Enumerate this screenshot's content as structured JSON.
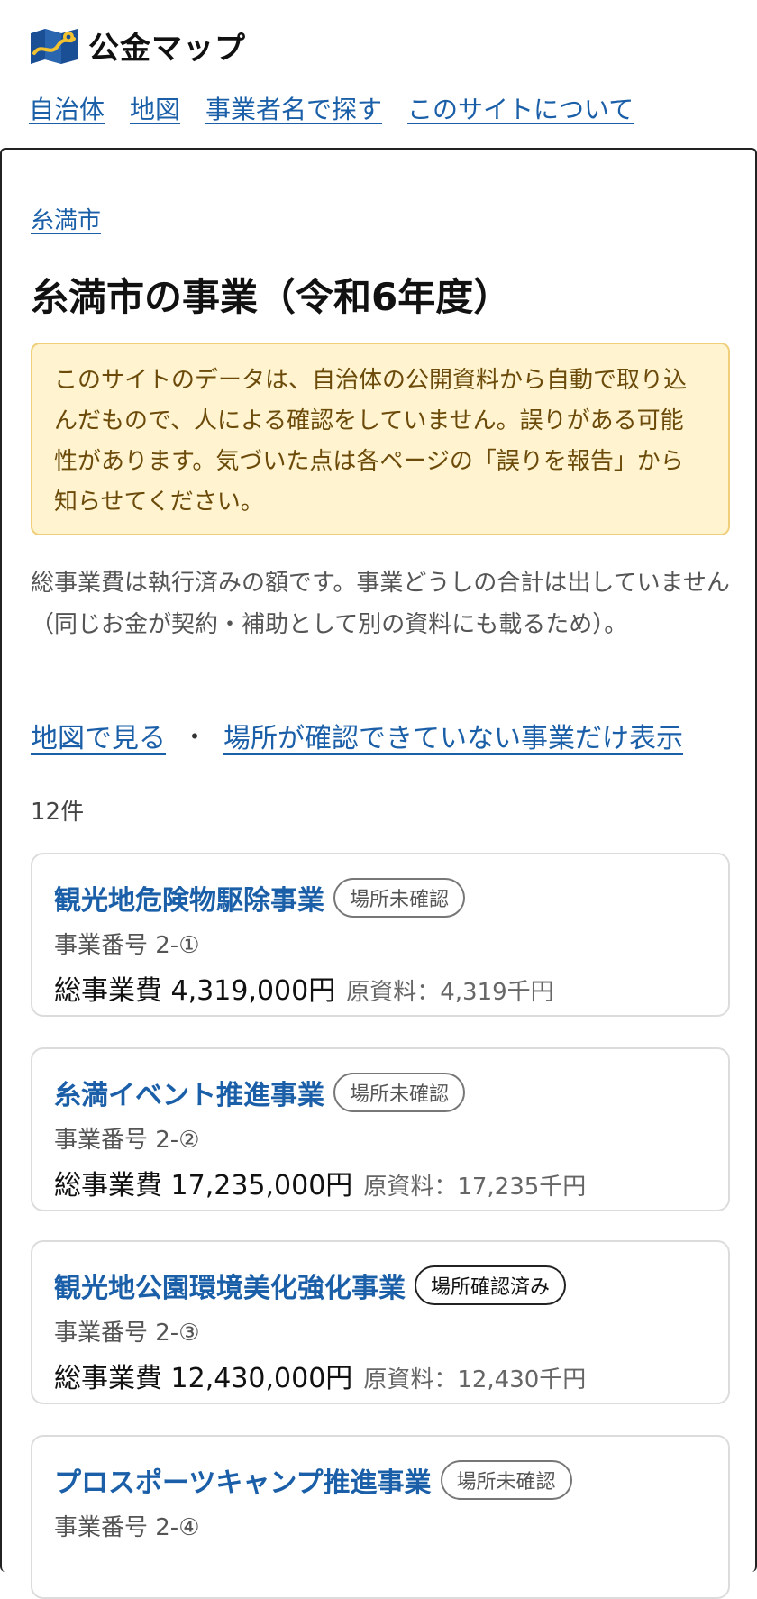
{
  "site": {
    "name": "公金マップ"
  },
  "nav": [
    {
      "label": "自治体"
    },
    {
      "label": "地図"
    },
    {
      "label": "事業者名で探す"
    },
    {
      "label": "このサイトについて"
    }
  ],
  "breadcrumb": "糸満市",
  "page_title": "糸満市の事業（令和6年度）",
  "notice": "このサイトのデータは、自治体の公開資料から自動で取り込んだもので、人による確認をしていません。誤りがある可能性があります。気づいた点は各ページの「誤りを報告」から知らせてください。",
  "description": "総事業費は執行済みの額です。事業どうしの合計は出していません（同じお金が契約・補助として別の資料にも載るため）。",
  "links": {
    "map": "地図で見る",
    "separator": "・",
    "unlocated": "場所が確認できていない事業だけ表示"
  },
  "count": "12件",
  "projects": [
    {
      "title": "観光地危険物駆除事業",
      "badge": "場所未確認",
      "number": "事業番号 2-①",
      "cost": "総事業費 4,319,000円",
      "source": "原資料：4,319千円"
    },
    {
      "title": "糸満イベント推進事業",
      "badge": "場所未確認",
      "number": "事業番号 2-②",
      "cost": "総事業費 17,235,000円",
      "source": "原資料：17,235千円"
    },
    {
      "title": "観光地公園環境美化強化事業",
      "badge": "場所確認済み",
      "number": "事業番号 2-③",
      "cost": "総事業費 12,430,000円",
      "source": "原資料：12,430千円"
    },
    {
      "title": "プロスポーツキャンプ推進事業",
      "badge": "場所未確認",
      "number": "事業番号 2-④",
      "cost": "",
      "source": ""
    }
  ],
  "colors": {
    "link": "#1a5fa8",
    "notice_bg": "#fff4cf",
    "notice_border": "#f0cf7a",
    "notice_text": "#6b4a0a"
  },
  "icons": {
    "logo": "map-logo-icon"
  }
}
